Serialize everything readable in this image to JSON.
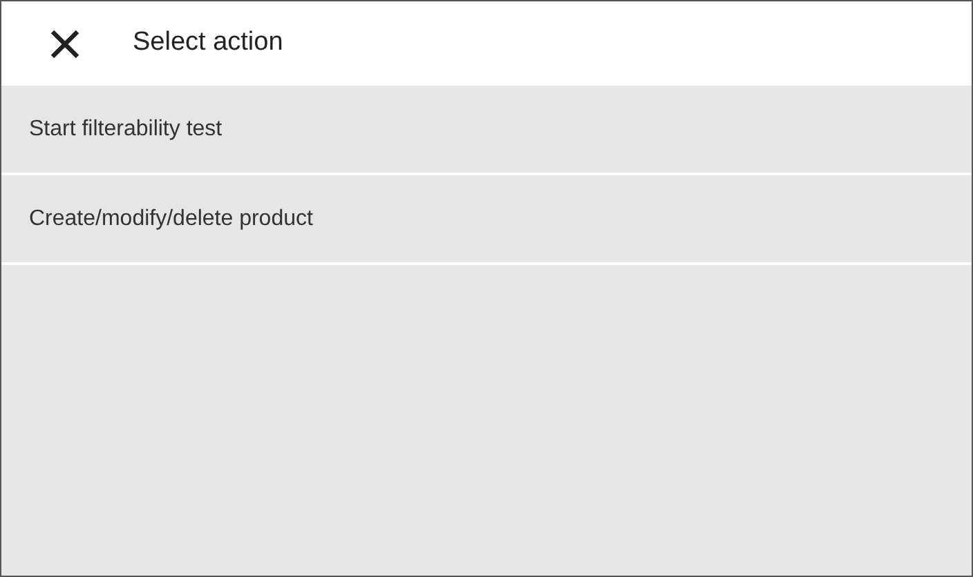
{
  "header": {
    "title": "Select action"
  },
  "actions": [
    {
      "label": "Start filterability test"
    },
    {
      "label": "Create/modify/delete product"
    }
  ]
}
